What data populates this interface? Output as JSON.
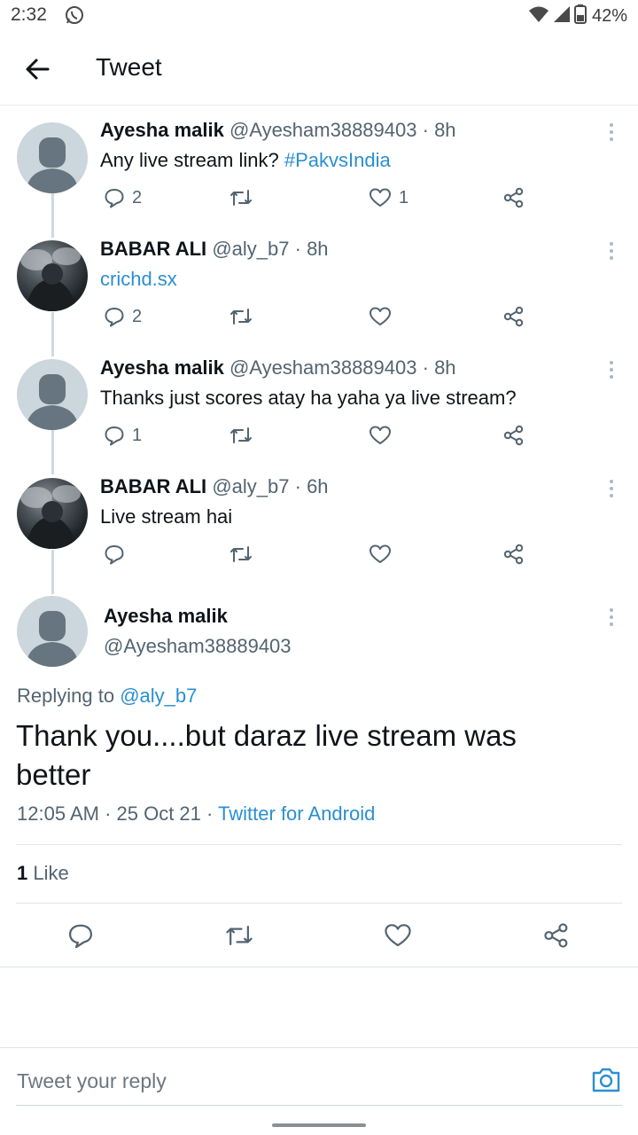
{
  "status_bar": {
    "time": "2:32",
    "battery": "42%"
  },
  "header": {
    "title": "Tweet"
  },
  "thread": [
    {
      "name": "Ayesha malik",
      "handle": "@Ayesham38889403",
      "time": "8h",
      "body_text": "Any live stream link? ",
      "body_link": "#PakvsIndia",
      "replies": "2",
      "likes": "1",
      "avatar": "default"
    },
    {
      "name": "BABAR ALI",
      "handle": "@aly_b7",
      "time": "8h",
      "body_text": "",
      "body_link": "crichd.sx",
      "replies": "2",
      "likes": "",
      "avatar": "photo"
    },
    {
      "name": "Ayesha malik",
      "handle": "@Ayesham38889403",
      "time": "8h",
      "body_text": "Thanks just scores atay ha yaha ya live stream?",
      "body_link": "",
      "replies": "1",
      "likes": "",
      "avatar": "default"
    },
    {
      "name": "BABAR ALI",
      "handle": "@aly_b7",
      "time": "6h",
      "body_text": "Live stream hai",
      "body_link": "",
      "replies": "",
      "likes": "",
      "avatar": "photo"
    }
  ],
  "focused": {
    "name": "Ayesha malik",
    "handle": "@Ayesham38889403",
    "replying_prefix": "Replying to ",
    "replying_to": "@aly_b7",
    "text_line1": "Thank you....but daraz live stream was",
    "text_line2": "better",
    "timestamp": "12:05 AM · 25 Oct 21 · ",
    "source": "Twitter for Android",
    "likes_count": "1",
    "likes_label": " Like"
  },
  "reply": {
    "placeholder": "Tweet your reply"
  },
  "colors": {
    "link": "#2b8fd0",
    "meta": "#536471",
    "border": "#dfe5e8"
  }
}
